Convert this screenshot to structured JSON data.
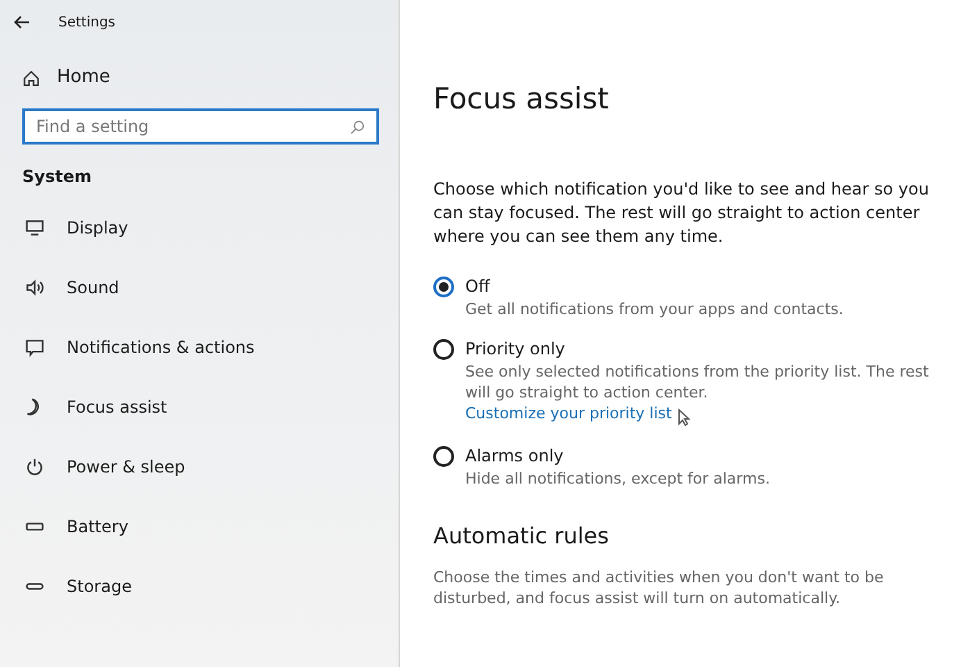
{
  "window": {
    "title": "Settings"
  },
  "sidebar": {
    "home": "Home",
    "search": {
      "placeholder": "Find a setting"
    },
    "section": "System",
    "items": [
      {
        "label": "Display",
        "kind": "display"
      },
      {
        "label": "Sound",
        "kind": "sound"
      },
      {
        "label": "Notifications & actions",
        "kind": "notifications"
      },
      {
        "label": "Focus assist",
        "kind": "moon"
      },
      {
        "label": "Power & sleep",
        "kind": "power"
      },
      {
        "label": "Battery",
        "kind": "battery"
      },
      {
        "label": "Storage",
        "kind": "storage"
      }
    ]
  },
  "page": {
    "title": "Focus assist",
    "intro": "Choose which notification you'd like to see and hear so you can stay focused. The rest will go straight to action center where you can see them any time.",
    "options": [
      {
        "label": "Off",
        "description": "Get all notifications from your apps and contacts.",
        "selected": true
      },
      {
        "label": "Priority only",
        "description": "See only selected notifications from the priority list. The rest will go straight to action center.",
        "link": "Customize your priority list",
        "selected": false
      },
      {
        "label": "Alarms only",
        "description": "Hide all notifications, except for alarms.",
        "selected": false
      }
    ],
    "rules_heading": "Automatic rules",
    "rules_text": "Choose the times and activities when you don't want to be disturbed, and focus assist will turn on automatically."
  }
}
